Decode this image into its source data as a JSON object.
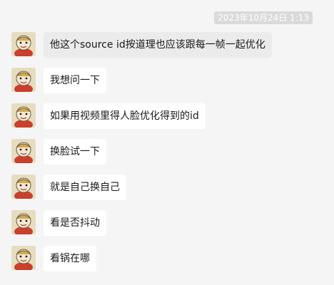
{
  "conversation": {
    "timestamp": "2023年10月24日 1:13",
    "messages": [
      {
        "text": "他这个source id按道理也应该跟每一帧一起优化"
      },
      {
        "text": "我想问一下"
      },
      {
        "text": "如果用视频里得人脸优化得到的id"
      },
      {
        "text": "换脸试一下"
      },
      {
        "text": "就是自己换自己"
      },
      {
        "text": "看是否抖动"
      },
      {
        "text": "看锅在哪"
      }
    ]
  },
  "colors": {
    "background": "#f5f5f5",
    "bubble_incoming": "#ffffff",
    "bubble_highlight": "#ebebeb",
    "timestamp_bg": "#dadada",
    "timestamp_text": "#ffffff"
  }
}
